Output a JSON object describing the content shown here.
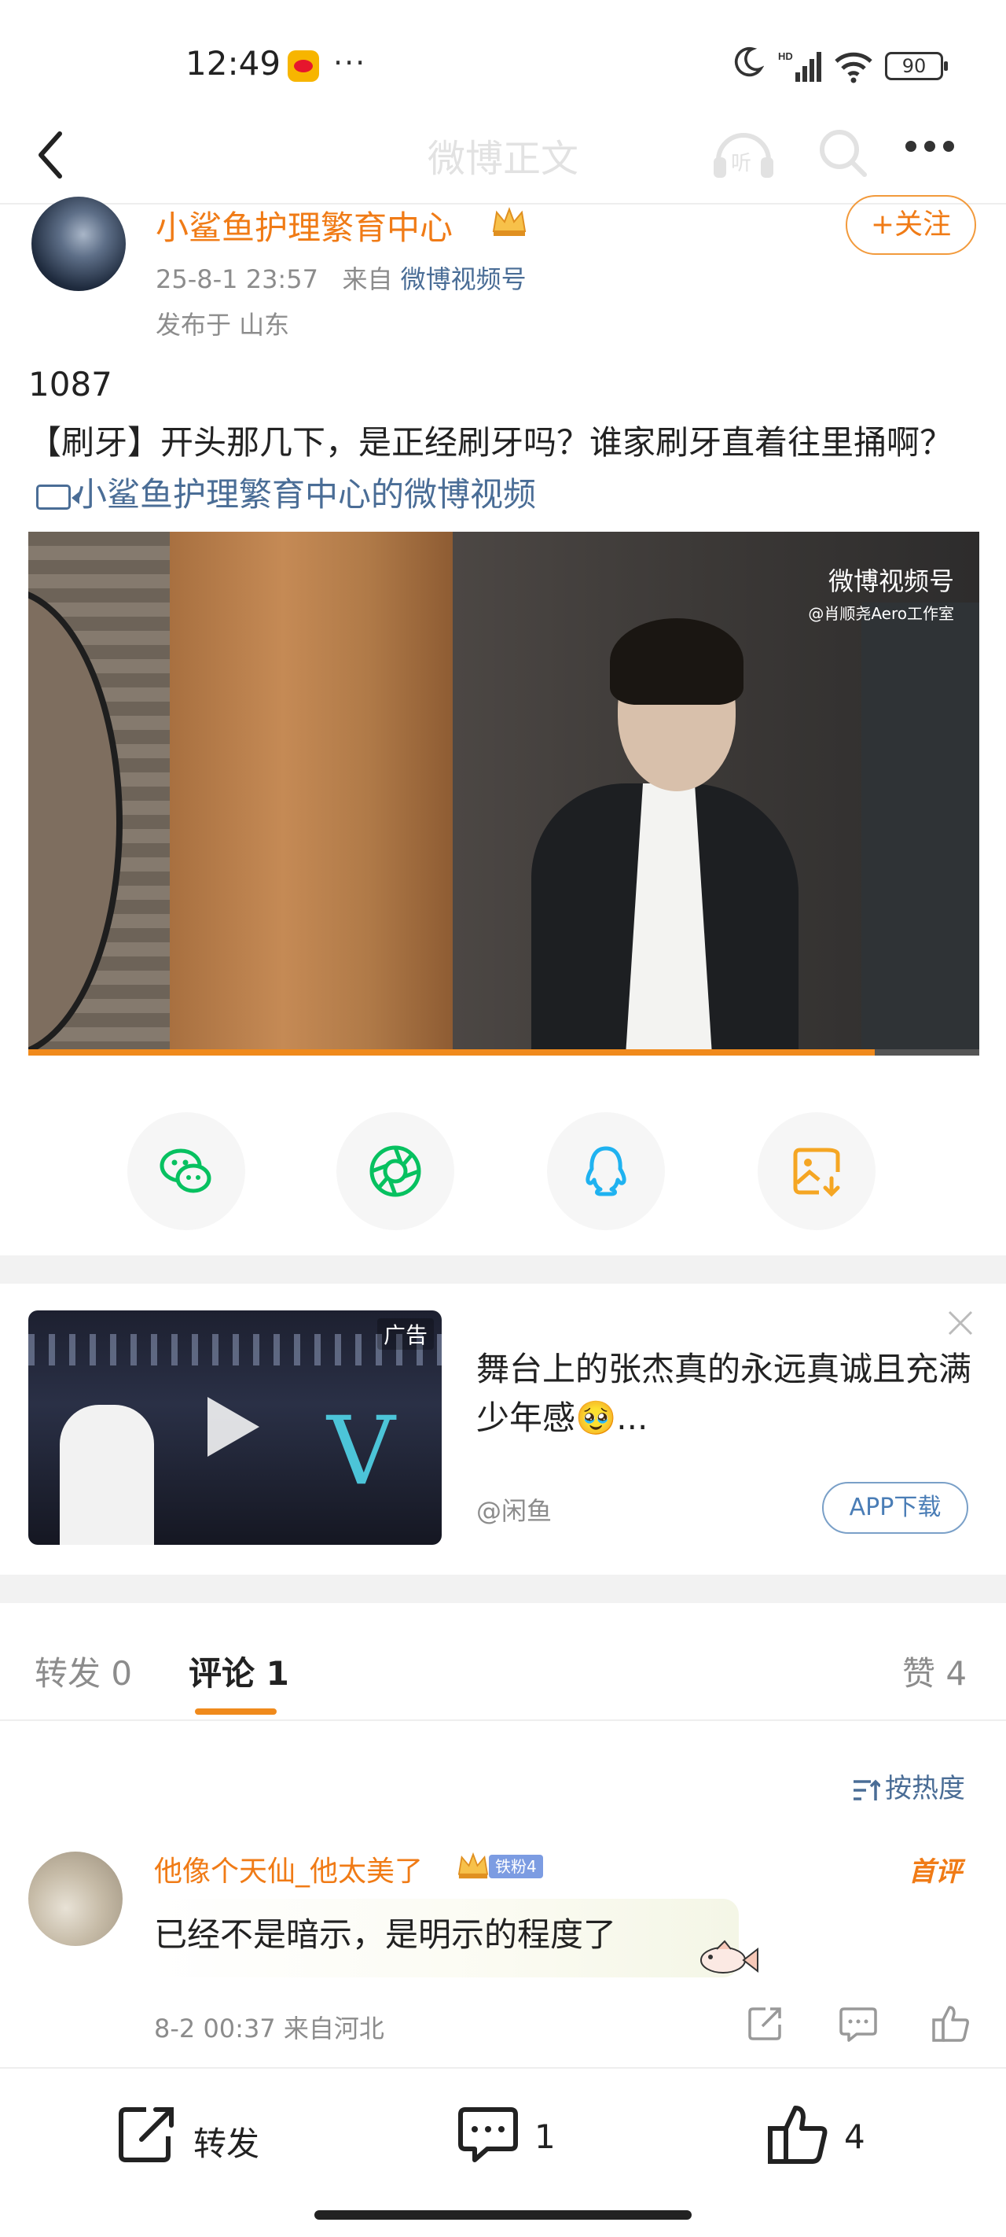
{
  "status_bar": {
    "time": "12:49",
    "more_indicator": "···",
    "battery": "90",
    "icons": [
      "weibo-app-icon",
      "moon-icon",
      "hd-signal-icon",
      "wifi-icon",
      "battery-icon"
    ]
  },
  "header": {
    "title": "微博正文",
    "icons": [
      "back-icon",
      "listen-icon",
      "search-icon",
      "more-icon"
    ]
  },
  "post": {
    "author": "小鲨鱼护理繁育中心",
    "date": "25-8-1 23:57",
    "from_label": "来自",
    "source": "微博视频号",
    "location": "发布于 山东",
    "follow_label": "+关注",
    "number": "1087",
    "text": "【刷牙】开头那几下，是正经刷牙吗？谁家刷牙直着往里捅啊？",
    "video_link": "小鲨鱼护理繁育中心的微博视频",
    "video": {
      "watermark": "微博视频号",
      "watermark_sub": "@肖顺尧Aero工作室",
      "progress": 0.89
    }
  },
  "share": {
    "icons": [
      "wechat-icon",
      "moments-icon",
      "qq-icon",
      "save-image-icon"
    ],
    "colors": [
      "#07c160",
      "#07c160",
      "#1fb2f0",
      "#f5a623"
    ]
  },
  "ad": {
    "badge": "广告",
    "text": "舞台上的张杰真的永远真诚且充满少年感🥹...",
    "source": "@闲鱼",
    "download_label": "APP下载"
  },
  "tabs": {
    "repost": "转发 0",
    "comment": "评论 1",
    "like": "赞 4"
  },
  "sort_label": "按热度",
  "comment": {
    "username": "他像个天仙_他太美了",
    "fan_badge": "铁粉4",
    "top_badge": "首评",
    "text": "已经不是暗示，是明示的程度了",
    "meta": "8-2 00:37 来自河北"
  },
  "bottom_bar": {
    "repost_label": "转发",
    "comment_count": "1",
    "like_count": "4"
  },
  "colors": {
    "accent_orange": "#f07b16",
    "link_blue": "#4a6d96"
  }
}
